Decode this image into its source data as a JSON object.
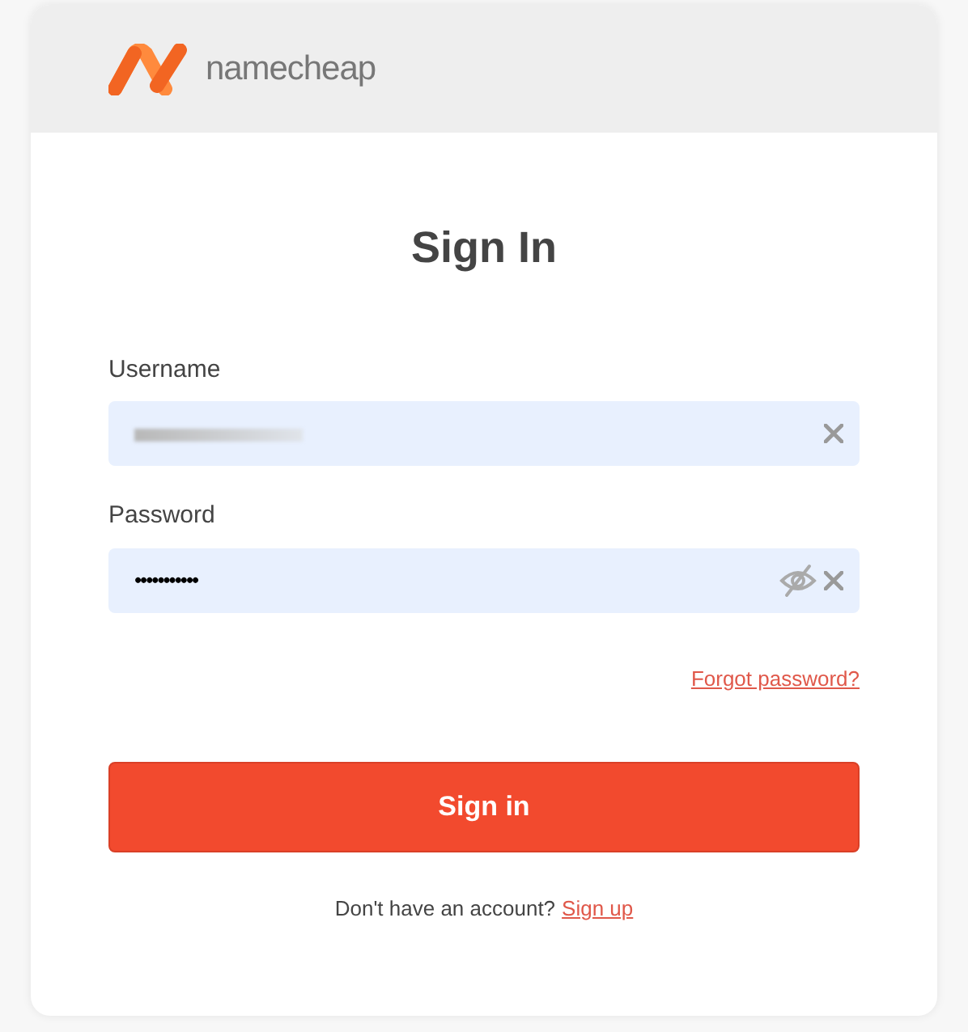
{
  "header": {
    "brand": "namecheap"
  },
  "title": "Sign In",
  "fields": [
    {
      "label": "Username",
      "redacted": true,
      "clearable": true
    },
    {
      "label": "Password",
      "value": "•••••••••••",
      "clearable": true,
      "reveal_toggle": true
    }
  ],
  "forgot_link": "Forgot password?",
  "submit_button": "Sign in",
  "signup": {
    "prompt": "Don't have an account?",
    "link": "Sign up"
  }
}
